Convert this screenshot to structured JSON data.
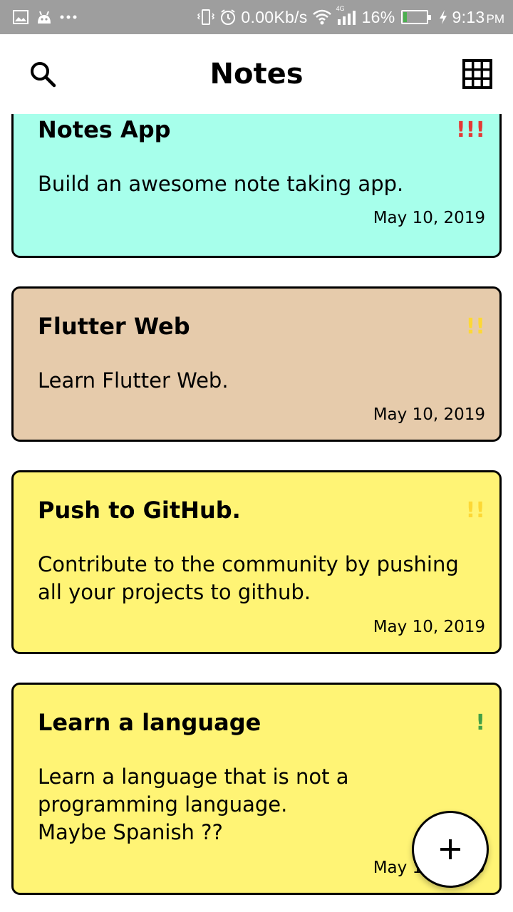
{
  "status_bar": {
    "speed": "0.00Kb/s",
    "network": "4G",
    "battery_percent": "16%",
    "battery_level": 0.16,
    "time": "9:13",
    "ampm": "PM",
    "icons": [
      "gallery-icon",
      "android-icon",
      "more-icon",
      "vibrate-icon",
      "alarm-icon",
      "wifi-icon",
      "signal-icon",
      "battery-icon",
      "charging-icon"
    ]
  },
  "app_bar": {
    "title": "Notes",
    "left_icon": "search-icon",
    "right_icon": "grid-icon"
  },
  "notes": [
    {
      "title": "Notes App",
      "priority": "!!!",
      "priority_color": "#e53935",
      "body": "Build an awesome note taking app.",
      "date": "May 10, 2019",
      "color": "#a7ffeb"
    },
    {
      "title": "Flutter Web",
      "priority": "!!",
      "priority_color": "#fdd835",
      "body": "Learn Flutter Web.",
      "date": "May 10, 2019",
      "color": "#e6cbab"
    },
    {
      "title": "Push to GitHub.",
      "priority": "!!",
      "priority_color": "#fdd835",
      "body": "Contribute to the community by pushing all your projects to github.",
      "date": "May 10, 2019",
      "color": "#fff475"
    },
    {
      "title": "Learn a language",
      "priority": "!",
      "priority_color": "#43a047",
      "body": "Learn a language that is not a programming language.\nMaybe Spanish ??",
      "date": "May 10, 2019",
      "color": "#fff475"
    }
  ],
  "fab": {
    "icon": "plus-icon"
  }
}
